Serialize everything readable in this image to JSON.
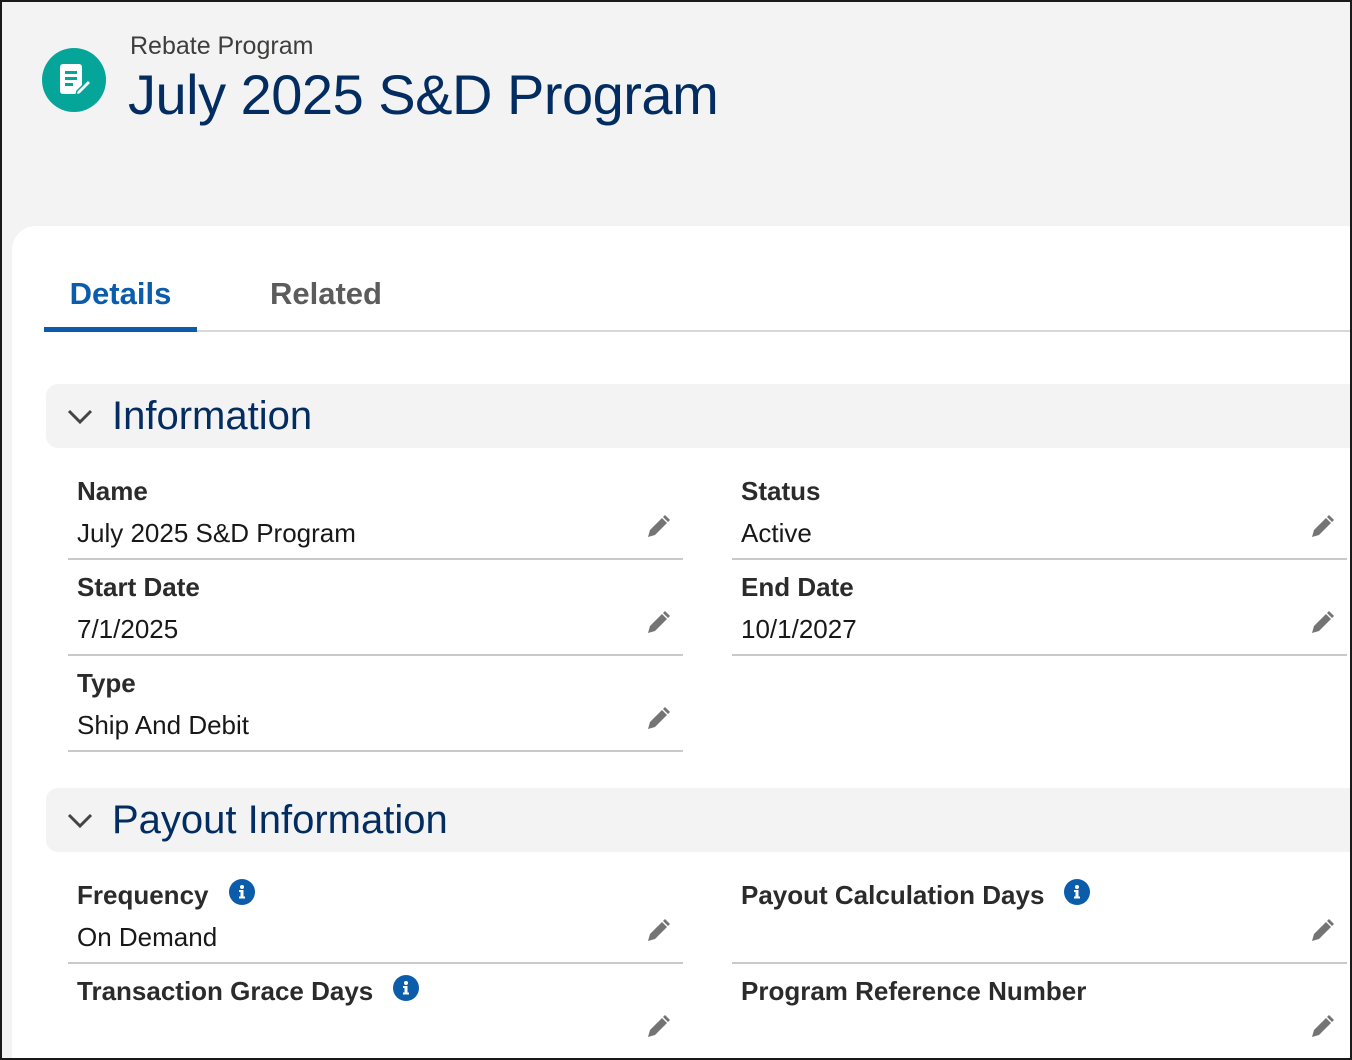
{
  "header": {
    "object_label": "Rebate Program",
    "record_title": "July 2025 S&D Program",
    "icon": "document-edit-icon"
  },
  "tabs": [
    {
      "label": "Details",
      "active": true
    },
    {
      "label": "Related",
      "active": false
    }
  ],
  "sections": [
    {
      "title": "Information",
      "fields": [
        {
          "label": "Name",
          "value": "July 2025 S&D Program"
        },
        {
          "label": "Status",
          "value": "Active"
        },
        {
          "label": "Start Date",
          "value": "7/1/2025"
        },
        {
          "label": "End Date",
          "value": "10/1/2027"
        },
        {
          "label": "Type",
          "value": "Ship And Debit"
        }
      ]
    },
    {
      "title": "Payout Information",
      "fields": [
        {
          "label": "Frequency",
          "value": "On Demand",
          "info": true
        },
        {
          "label": "Payout Calculation Days",
          "value": "",
          "info": true
        },
        {
          "label": "Transaction Grace Days",
          "value": "",
          "info": true
        },
        {
          "label": "Program Reference Number",
          "value": ""
        }
      ]
    }
  ],
  "colors": {
    "brand_icon": "#06a59a",
    "title": "#032d60",
    "tab_active": "#0b5cab",
    "info_icon": "#0b5cab"
  }
}
